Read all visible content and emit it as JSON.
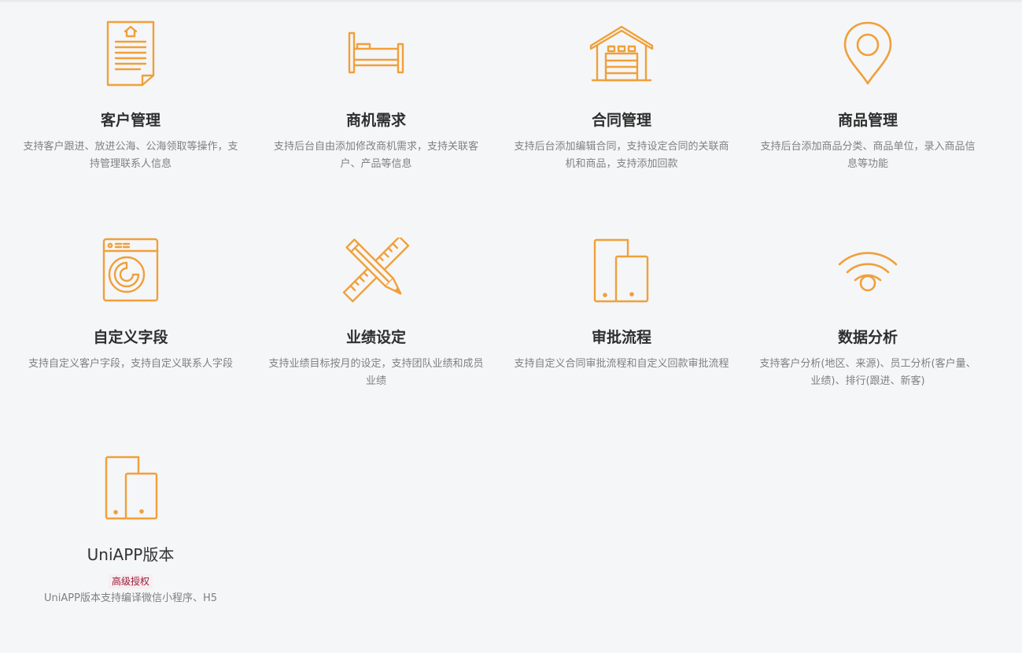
{
  "accent_color": "#f0a03a",
  "features": [
    {
      "icon": "document-icon",
      "title": "客户管理",
      "desc": "支持客户跟进、放进公海、公海领取等操作，支持管理联系人信息"
    },
    {
      "icon": "bed-icon",
      "title": "商机需求",
      "desc": "支持后台自由添加修改商机需求，支持关联客户、产品等信息"
    },
    {
      "icon": "warehouse-icon",
      "title": "合同管理",
      "desc": "支持后台添加编辑合同，支持设定合同的关联商机和商品，支持添加回款"
    },
    {
      "icon": "location-pin-icon",
      "title": "商品管理",
      "desc": "支持后台添加商品分类、商品单位，录入商品信息等功能"
    },
    {
      "icon": "washing-machine-icon",
      "title": "自定义字段",
      "desc": "支持自定义客户字段，支持自定义联系人字段"
    },
    {
      "icon": "pencil-ruler-icon",
      "title": "业绩设定",
      "desc": "支持业绩目标按月的设定，支持团队业绩和成员业绩"
    },
    {
      "icon": "tablet-phone-icon",
      "title": "审批流程",
      "desc": "支持自定义合同审批流程和自定义回款审批流程"
    },
    {
      "icon": "wifi-icon",
      "title": "数据分析",
      "desc": "支持客户分析(地区、来源)、员工分析(客户量、业绩)、排行(跟进、新客)"
    },
    {
      "icon": "tablet-phone-icon",
      "title": "UniAPP版本",
      "badge": "高级授权",
      "desc": "UniAPP版本支持编译微信小程序、H5"
    }
  ]
}
